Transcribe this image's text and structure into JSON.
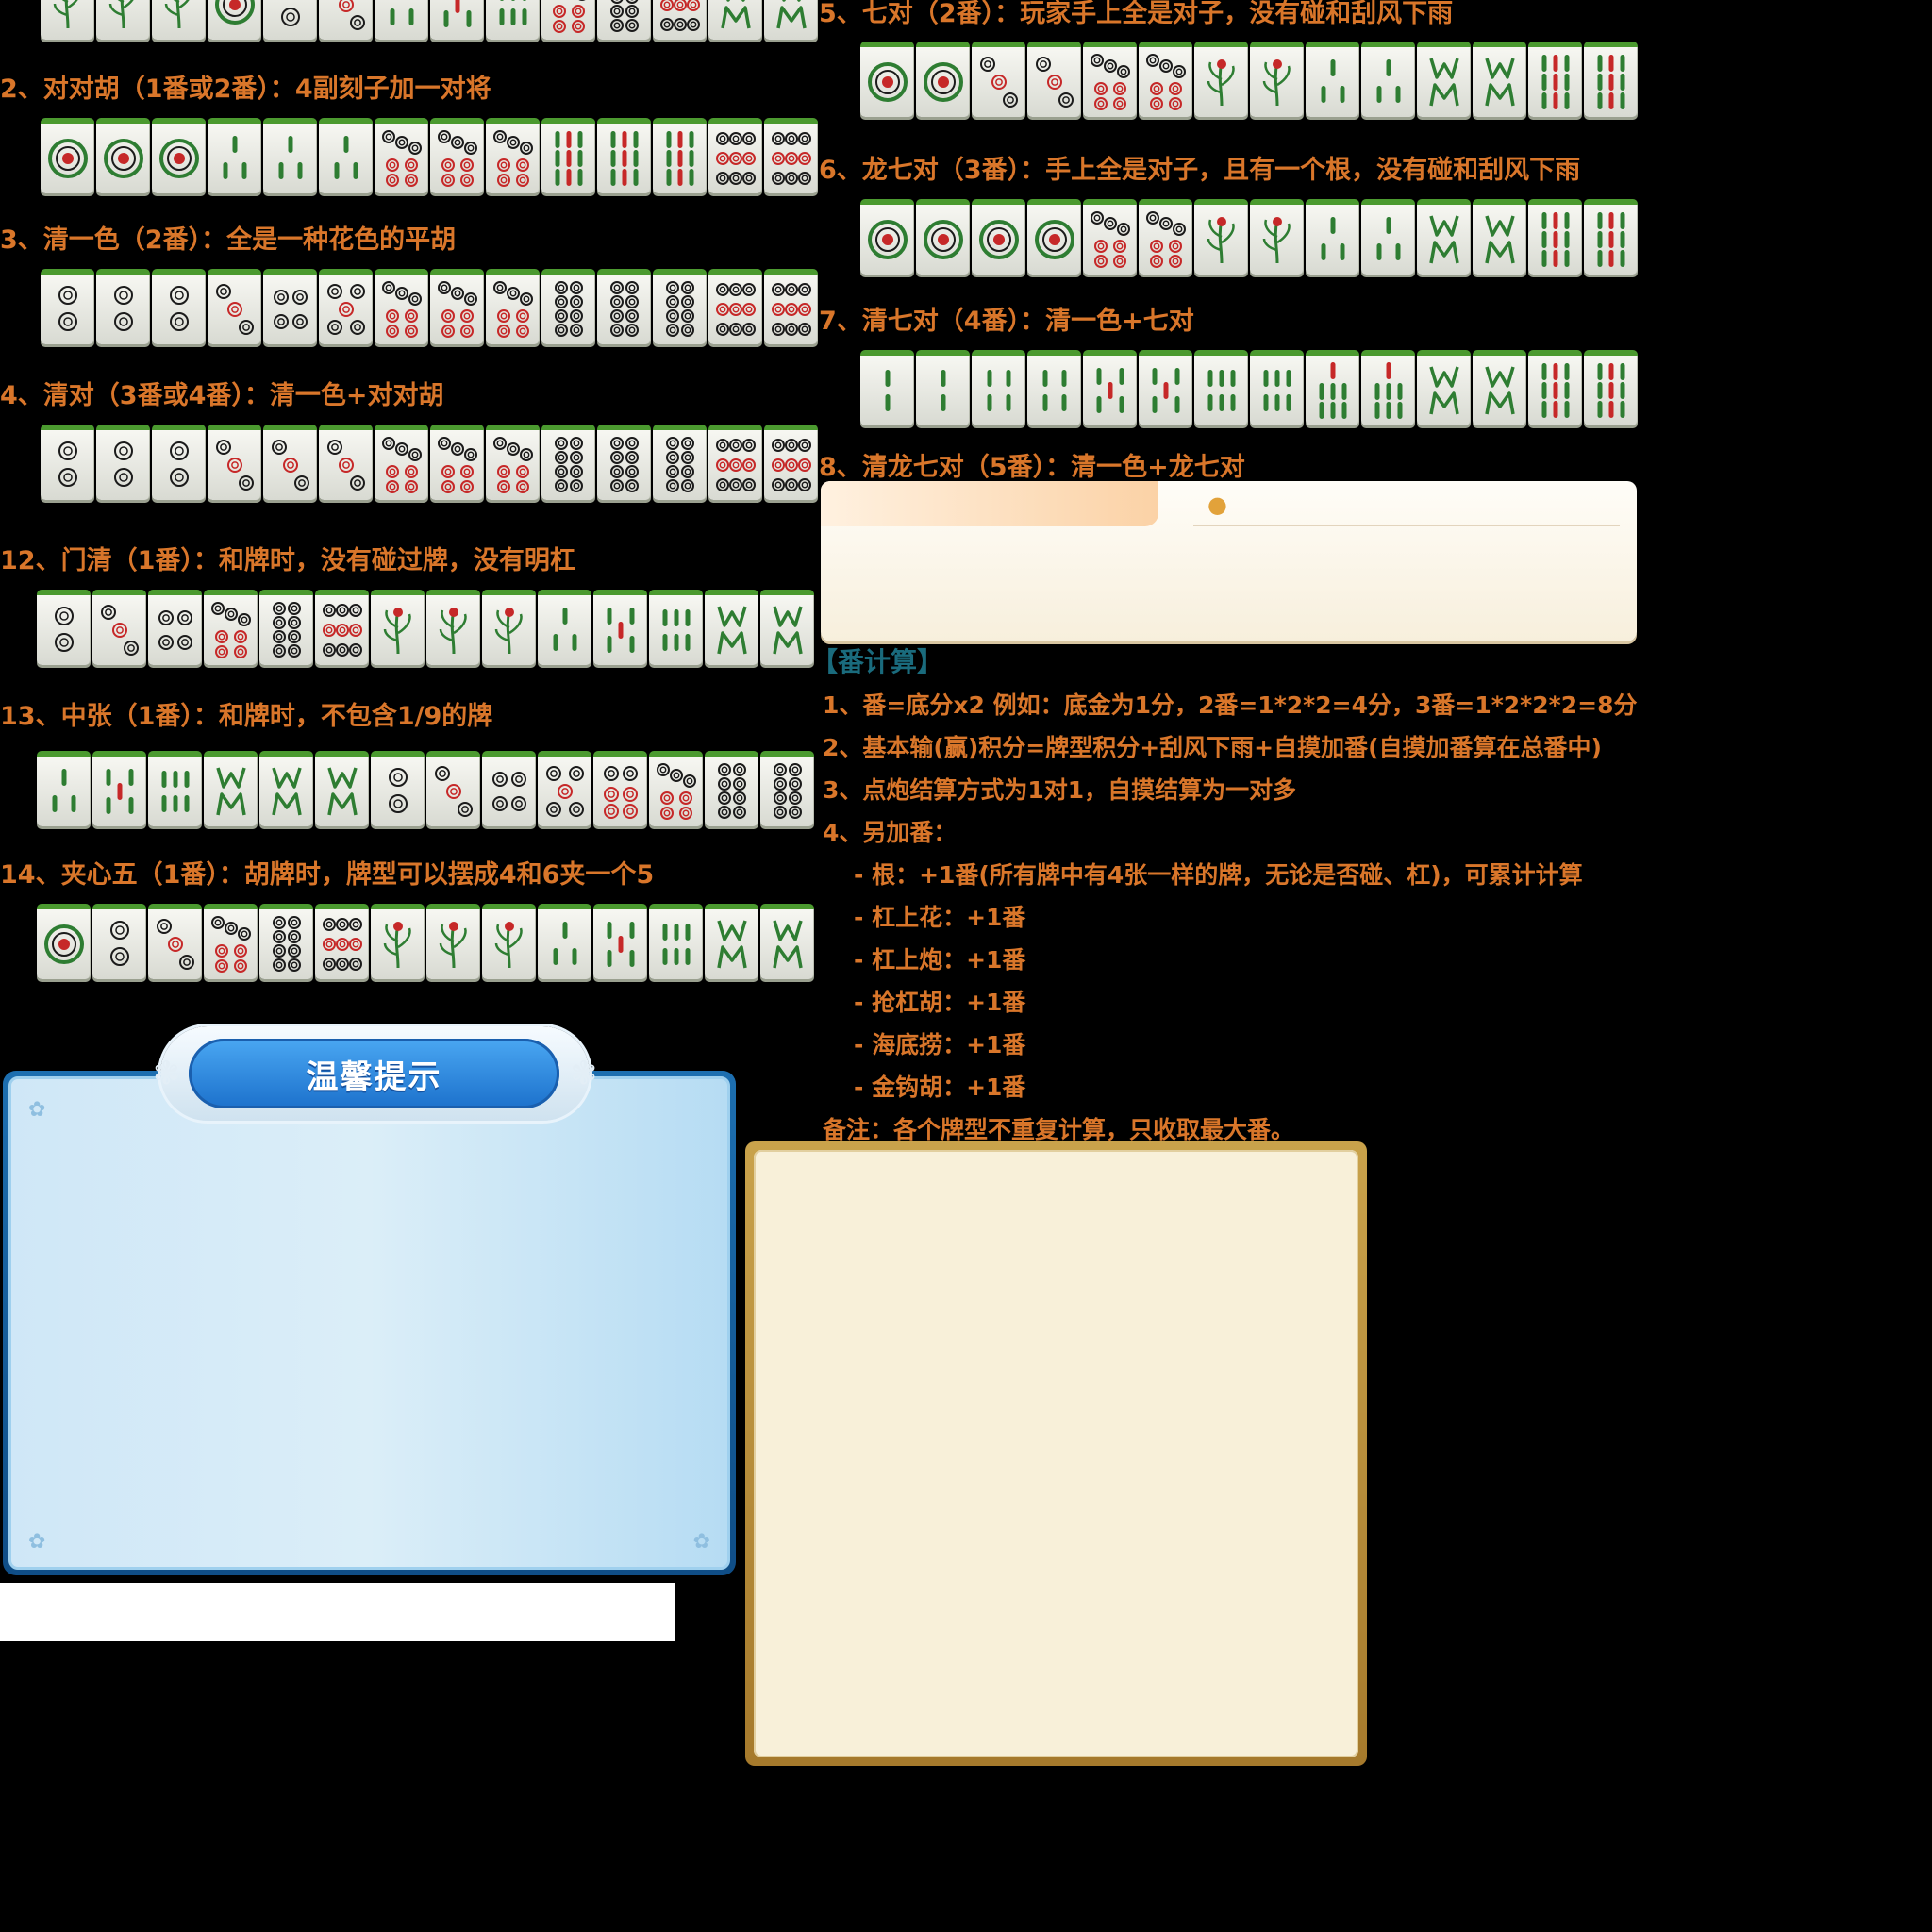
{
  "sections": [
    {
      "label": "2、对对胡（1番或2番）：4副刻子加一对将",
      "tiles": [
        "d1",
        "d1",
        "d1",
        "b3",
        "b3",
        "b3",
        "d7",
        "d7",
        "d7",
        "b9",
        "b9",
        "b9",
        "d9",
        "d9"
      ]
    },
    {
      "label": "3、清一色（2番）：全是一种花色的平胡",
      "tiles": [
        "d2",
        "d2",
        "d2",
        "d3",
        "d4",
        "d5",
        "d7",
        "d7",
        "d7",
        "d8",
        "d8",
        "d8",
        "d9",
        "d9"
      ]
    },
    {
      "label": "4、清对（3番或4番）：清一色+对对胡",
      "tiles": [
        "d2",
        "d2",
        "d2",
        "d3",
        "d3",
        "d3",
        "d7",
        "d7",
        "d7",
        "d8",
        "d8",
        "d8",
        "d9",
        "d9"
      ]
    },
    {
      "label": "12、门清（1番）：和牌时，没有碰过牌，没有明杠",
      "tiles": [
        "d2",
        "d3",
        "d4",
        "d7",
        "d8",
        "d9",
        "b1",
        "b1",
        "b1",
        "b3",
        "b5",
        "b6",
        "c",
        "c"
      ]
    },
    {
      "label": "13、中张（1番）：和牌时，不包含1/9的牌",
      "tiles": [
        "b3",
        "b5",
        "b6",
        "c",
        "c",
        "c",
        "d2",
        "d3",
        "d4",
        "d5",
        "d6",
        "d7",
        "d8",
        "d8"
      ]
    },
    {
      "label": "14、夹心五（1番）：胡牌时，牌型可以摆成4和6夹一个5",
      "tiles": [
        "d1",
        "d2",
        "d3",
        "d7",
        "d8",
        "d9",
        "b1",
        "b1",
        "b1",
        "b3",
        "b5",
        "b6",
        "c",
        "c"
      ]
    },
    {
      "label": "5、七对（2番）：玩家手上全是对子，没有碰和刮风下雨",
      "tiles": [
        "d1",
        "d1",
        "d3",
        "d3",
        "d7",
        "d7",
        "b1",
        "b1",
        "b3",
        "b3",
        "c",
        "c",
        "b9",
        "b9"
      ]
    },
    {
      "label": "6、龙七对（3番）：手上全是对子，且有一个根，没有碰和刮风下雨",
      "tiles": [
        "d1",
        "d1",
        "d1",
        "d1",
        "d7",
        "d7",
        "b1",
        "b1",
        "b3",
        "b3",
        "c",
        "c",
        "b9",
        "b9"
      ]
    },
    {
      "label": "7、清七对（4番）：清一色+七对",
      "tiles": [
        "b2",
        "b2",
        "b4",
        "b4",
        "b5",
        "b5",
        "b6",
        "b6",
        "b7",
        "b7",
        "c",
        "c",
        "b9",
        "b9"
      ]
    },
    {
      "label": "8、清龙七对（5番）：清一色+龙七对",
      "tiles": []
    }
  ],
  "top_partial_row": [
    "b1",
    "b1",
    "b1",
    "d1",
    "d2",
    "d3",
    "b3",
    "b5",
    "b6",
    "d7",
    "d8",
    "d9",
    "c",
    "c"
  ],
  "fan_calc": {
    "title": "【番计算】",
    "lines": [
      "1、番=底分x2 例如：底金为1分，2番=1*2*2=4分，3番=1*2*2*2=8分",
      "2、基本输(赢)积分=牌型积分+刮风下雨+自摸加番(自摸加番算在总番中)",
      "3、点炮结算方式为1对1，自摸结算为一对多",
      "4、另加番：",
      "  - 根：+1番(所有牌中有4张一样的牌，无论是否碰、杠)，可累计计算",
      "  - 杠上花：+1番",
      "  - 杠上炮：+1番",
      "  - 抢杠胡：+1番",
      "  - 海底捞：+1番",
      "  - 金钩胡：+1番",
      "备注：各个牌型不重复计算，只收取最大番。"
    ]
  },
  "tip": {
    "title": "温馨提示"
  },
  "colors": {
    "label": "#d9762a",
    "accent": "#1a6b7d",
    "tile_back": "#4b9a2f"
  }
}
